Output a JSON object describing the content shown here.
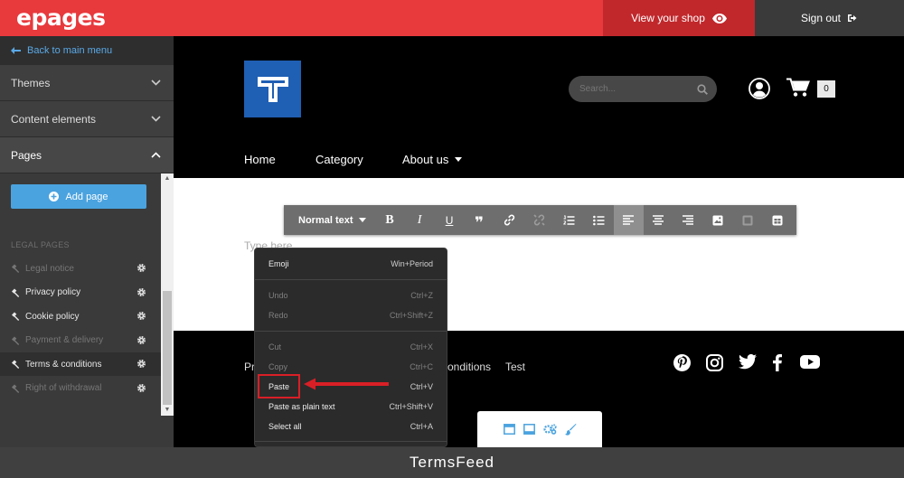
{
  "app": {
    "logo": "epages"
  },
  "topbar": {
    "view_shop": "View your shop",
    "sign_out": "Sign out"
  },
  "sidebar": {
    "back": "Back to main menu",
    "sections": {
      "themes": "Themes",
      "content": "Content elements",
      "pages": "Pages"
    },
    "add_page": "Add page",
    "legal_heading": "LEGAL PAGES",
    "legal_pages": [
      {
        "label": "Legal notice",
        "dim": true
      },
      {
        "label": "Privacy policy",
        "dim": false
      },
      {
        "label": "Cookie policy",
        "dim": false
      },
      {
        "label": "Payment & delivery",
        "dim": true
      },
      {
        "label": "Terms & conditions",
        "dim": false
      },
      {
        "label": "Right of withdrawal",
        "dim": true
      }
    ]
  },
  "shop": {
    "search_placeholder": "Search...",
    "cart_count": "0",
    "nav": [
      "Home",
      "Category",
      "About us"
    ],
    "editor_placeholder": "Type here",
    "footer_links": {
      "first_fragment": "Pr",
      "conditions_fragment": "onditions",
      "test": "Test"
    }
  },
  "toolbar": {
    "format": "Normal text"
  },
  "context_menu": {
    "items": [
      {
        "label": "Emoji",
        "shortcut": "Win+Period",
        "disabled": false
      },
      {
        "label": "Undo",
        "shortcut": "Ctrl+Z",
        "disabled": true
      },
      {
        "label": "Redo",
        "shortcut": "Ctrl+Shift+Z",
        "disabled": true
      },
      {
        "label": "Cut",
        "shortcut": "Ctrl+X",
        "disabled": true
      },
      {
        "label": "Copy",
        "shortcut": "Ctrl+C",
        "disabled": true
      },
      {
        "label": "Paste",
        "shortcut": "Ctrl+V",
        "disabled": false
      },
      {
        "label": "Paste as plain text",
        "shortcut": "Ctrl+Shift+V",
        "disabled": false
      },
      {
        "label": "Select all",
        "shortcut": "Ctrl+A",
        "disabled": false
      }
    ]
  },
  "banner": {
    "text": "TermsFeed"
  },
  "colors": {
    "brand_red": "#e8393d",
    "accent_blue": "#4aa3df",
    "highlight_red": "#d91f26"
  }
}
